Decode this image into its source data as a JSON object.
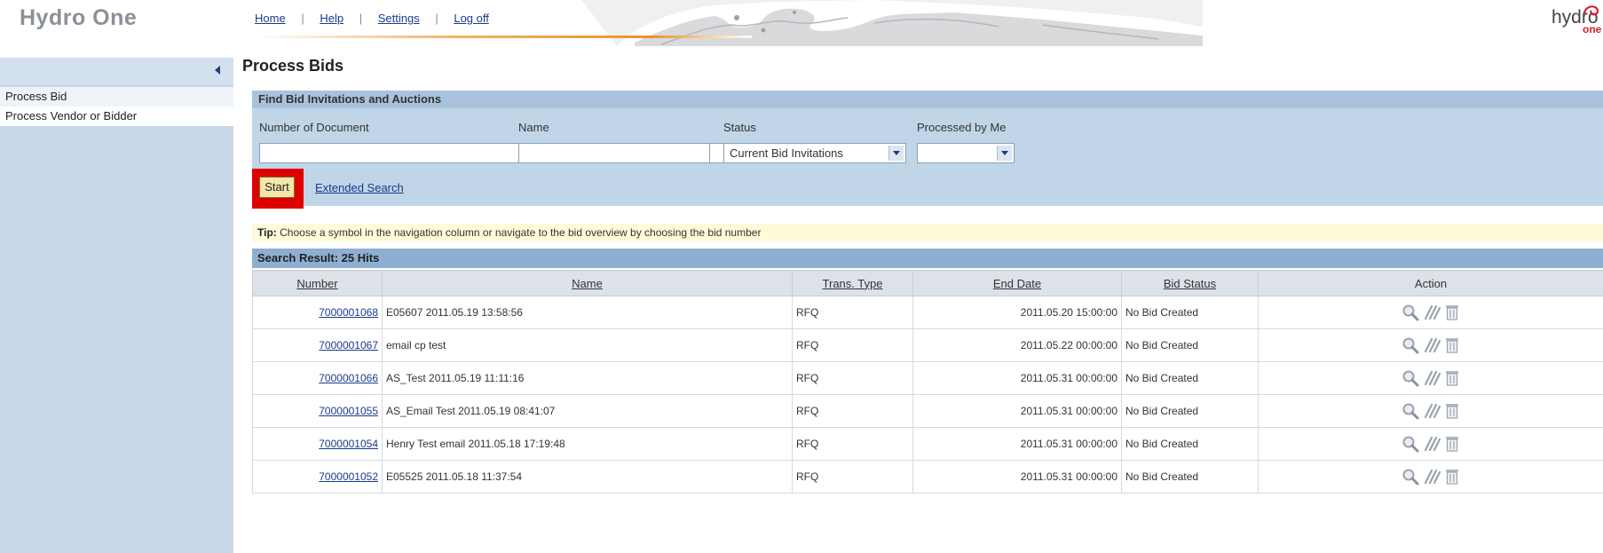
{
  "header": {
    "brand": "Hydro One",
    "nav": [
      "Home",
      "Help",
      "Settings",
      "Log off"
    ],
    "nav_separator": "|",
    "logo_word": "hydro",
    "logo_sub": "one",
    "logo_color": "#d3202f"
  },
  "sidebar": {
    "items": [
      {
        "label": "Process Bid",
        "active": true
      },
      {
        "label": "Process Vendor or Bidder",
        "active": false
      }
    ]
  },
  "page": {
    "title": "Process Bids"
  },
  "search": {
    "title": "Find Bid Invitations and Auctions",
    "labels": {
      "number": "Number of Document",
      "name": "Name",
      "status": "Status",
      "processed": "Processed by Me"
    },
    "values": {
      "number": "",
      "name": "",
      "status": "Current Bid Invitations",
      "processed": ""
    },
    "start_label": "Start",
    "extended_label": "Extended Search"
  },
  "tip": {
    "label": "Tip:",
    "text": "Choose a symbol in the navigation column or navigate to the bid overview by choosing the bid number"
  },
  "results": {
    "title": "Search Result:  25 Hits",
    "columns": [
      "Number",
      "Name",
      "Trans. Type",
      "End Date",
      "Bid Status",
      "Action"
    ],
    "rows": [
      {
        "number": "7000001068",
        "name": "E05607 2011.05.19 13:58:56",
        "type": "RFQ",
        "end": "2011.05.20 15:00:00",
        "status": "No Bid Created"
      },
      {
        "number": "7000001067",
        "name": "email cp test",
        "type": "RFQ",
        "end": "2011.05.22 00:00:00",
        "status": "No Bid Created"
      },
      {
        "number": "7000001066",
        "name": "AS_Test 2011.05.19 11:11:16",
        "type": "RFQ",
        "end": "2011.05.31 00:00:00",
        "status": "No Bid Created"
      },
      {
        "number": "7000001055",
        "name": "AS_Email Test 2011.05.19 08:41:07",
        "type": "RFQ",
        "end": "2011.05.31 00:00:00",
        "status": "No Bid Created"
      },
      {
        "number": "7000001054",
        "name": "Henry Test email 2011.05.18 17:19:48",
        "type": "RFQ",
        "end": "2011.05.31 00:00:00",
        "status": "No Bid Created"
      },
      {
        "number": "7000001052",
        "name": "E05525 2011.05.18 11:37:54",
        "type": "RFQ",
        "end": "2011.05.31 00:00:00",
        "status": "No Bid Created"
      }
    ],
    "row_actions": [
      "display-icon",
      "edit-icon",
      "delete-icon"
    ]
  }
}
